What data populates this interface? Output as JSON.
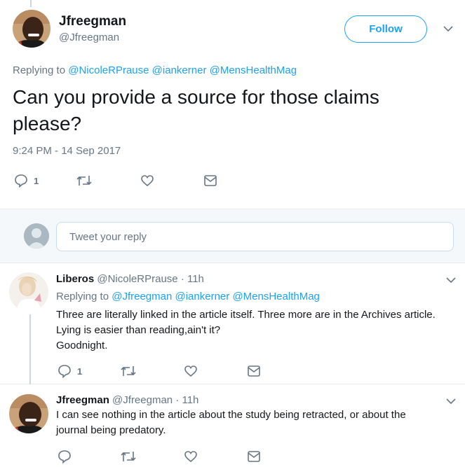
{
  "main_tweet": {
    "name": "Jfreegman",
    "handle": "@Jfreegman",
    "follow_label": "Follow",
    "replying_prefix": "Replying to",
    "mentions": [
      "@NicoleRPrause",
      "@iankerner",
      "@MensHealthMag"
    ],
    "text": "Can you provide a source for those claims please?",
    "timestamp": "9:24 PM - 14 Sep 2017",
    "reply_count": "1"
  },
  "reply_box": {
    "placeholder": "Tweet your reply"
  },
  "replies": [
    {
      "name": "Liberos",
      "handle": "@NicoleRPrause",
      "time": "· 11h",
      "replying_prefix": "Replying to",
      "mentions": [
        "@Jfreegman",
        "@iankerner",
        "@MensHealthMag"
      ],
      "lines": [
        "Three are literally linked in the article itself. Three more are in the Archives article.",
        "Lying is easier than reading,ain't it?",
        "Goodnight."
      ],
      "reply_count": "1"
    },
    {
      "name": "Jfreegman",
      "handle": "@Jfreegman",
      "time": "· 11h",
      "lines": [
        "I can see nothing in the article about the study being retracted, or about the",
        "journal being predatory."
      ]
    }
  ],
  "icons": [
    "reply-icon",
    "retweet-icon",
    "like-icon",
    "message-icon",
    "chevron-down-icon"
  ],
  "colors": {
    "accent": "#1da1f2",
    "muted": "#657786",
    "text": "#14171a",
    "divider": "#e6ecf0"
  }
}
